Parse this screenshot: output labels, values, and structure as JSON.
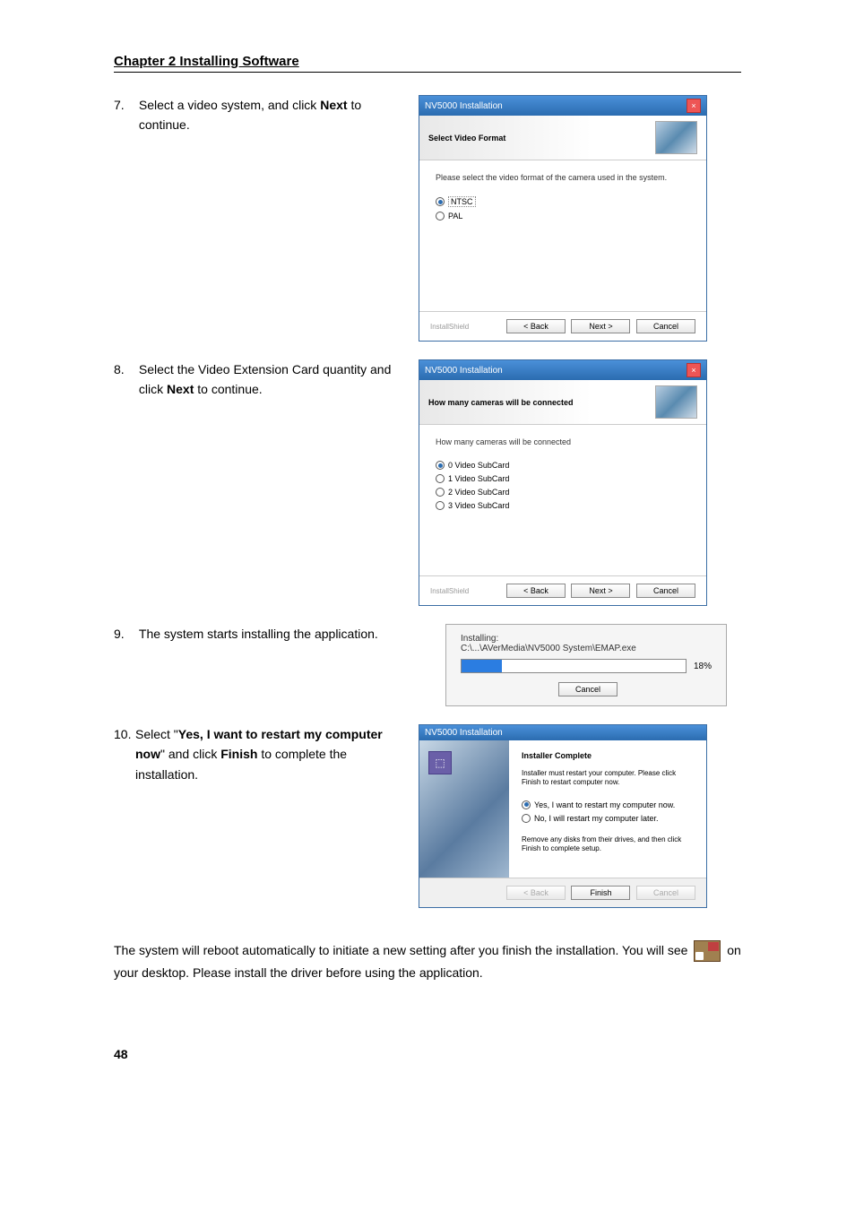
{
  "chapter_title": "Chapter 2 Installing Software",
  "steps": {
    "s7": {
      "num": "7.",
      "text_a": "Select a video system, and click ",
      "bold_a": "Next",
      "text_b": " to continue."
    },
    "s8": {
      "num": "8.",
      "text_a": "Select the Video Extension Card quantity and click ",
      "bold_a": "Next",
      "text_b": " to continue."
    },
    "s9": {
      "num": "9.",
      "text_a": "The system starts installing the application."
    },
    "s10": {
      "num": "10.",
      "text_a": "Select \"",
      "bold_a": "Yes, I want to restart my computer now",
      "text_b": "\" and click ",
      "bold_b": "Finish",
      "text_c": " to complete the installation."
    }
  },
  "dialog7": {
    "title": "NV5000 Installation",
    "header": "Select Video Format",
    "instruction": "Please select the video format of the camera used in the system.",
    "opt1": "NTSC",
    "opt2": "PAL",
    "brand": "InstallShield",
    "back": "< Back",
    "next": "Next >",
    "cancel": "Cancel"
  },
  "dialog8": {
    "title": "NV5000 Installation",
    "header": "How many cameras will be connected",
    "instruction": "How many cameras will be connected",
    "opt1": "0 Video SubCard",
    "opt2": "1 Video SubCard",
    "opt3": "2 Video SubCard",
    "opt4": "3 Video SubCard",
    "brand": "InstallShield",
    "back": "< Back",
    "next": "Next >",
    "cancel": "Cancel"
  },
  "dialog9": {
    "installing_label": "Installing:",
    "path": "C:\\...\\AVerMedia\\NV5000 System\\EMAP.exe",
    "percent": "18%",
    "cancel": "Cancel"
  },
  "dialog10": {
    "title": "NV5000 Installation",
    "header": "Installer Complete",
    "line1": "Installer must restart your computer. Please click Finish to restart computer now.",
    "opt_yes": "Yes, I want to restart my computer now.",
    "opt_no": "No, I will restart my computer later.",
    "line2": "Remove any disks from their drives, and then click Finish to complete setup.",
    "back": "< Back",
    "finish": "Finish",
    "cancel": "Cancel"
  },
  "paragraph": {
    "p1": "The system will reboot automatically to initiate a new setting after you finish the installation. You will see ",
    "p2": " on your desktop. Please install the driver before using the application."
  },
  "page_number": "48"
}
